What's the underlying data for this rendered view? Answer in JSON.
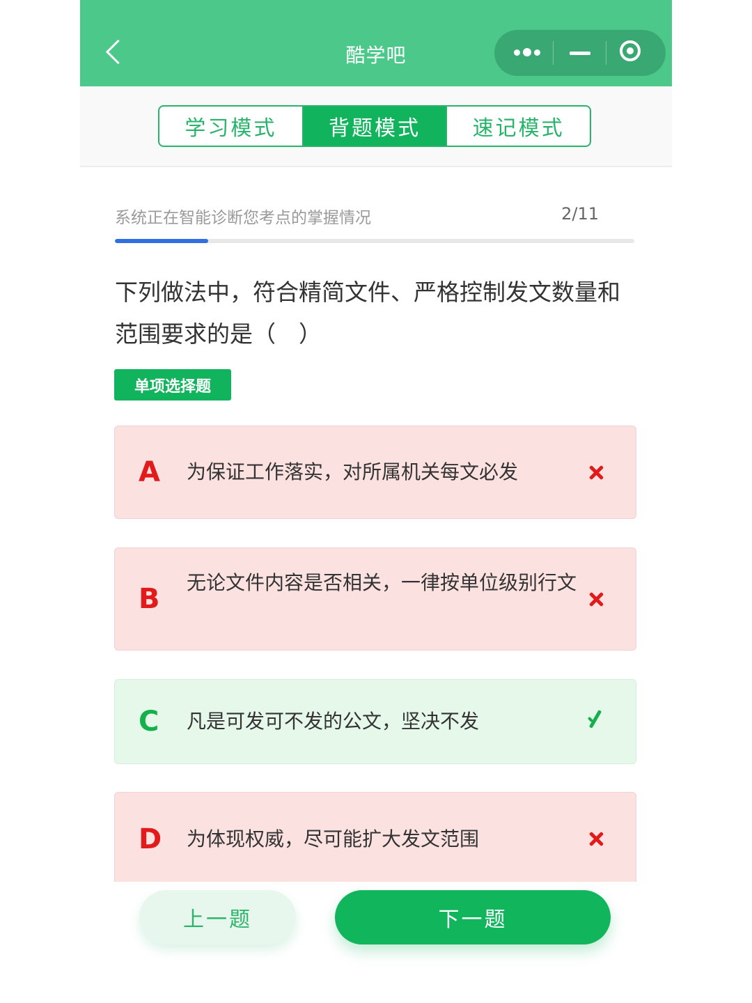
{
  "header": {
    "title": "酷学吧"
  },
  "tabs": [
    {
      "label": "学习模式",
      "active": false
    },
    {
      "label": "背题模式",
      "active": true
    },
    {
      "label": "速记模式",
      "active": false
    }
  ],
  "progress": {
    "status_text": "系统正在智能诊断您考点的掌握情况",
    "current": "2",
    "total": "11",
    "counter_text": "2/11",
    "fill_fraction": 0.18
  },
  "question": {
    "text": "下列做法中，符合精简文件、严格控制发文数量和范围要求的是（　）",
    "type_label": "单项选择题"
  },
  "options": [
    {
      "letter": "A",
      "text": "为保证工作落实，对所属机关每文必发",
      "result": "wrong"
    },
    {
      "letter": "B",
      "text": "无论文件内容是否相关，一律按单位级别行文",
      "result": "wrong"
    },
    {
      "letter": "C",
      "text": "凡是可发可不发的公文，坚决不发",
      "result": "correct"
    },
    {
      "letter": "D",
      "text": "为体现权威，尽可能扩大发文范围",
      "result": "wrong"
    }
  ],
  "nav": {
    "prev_label": "上一题",
    "next_label": "下一题"
  },
  "colors": {
    "header_bg": "#4cc98a",
    "accent_green": "#11b35c",
    "wrong_red": "#e11b1b",
    "progress_blue": "#2f6fe0"
  }
}
